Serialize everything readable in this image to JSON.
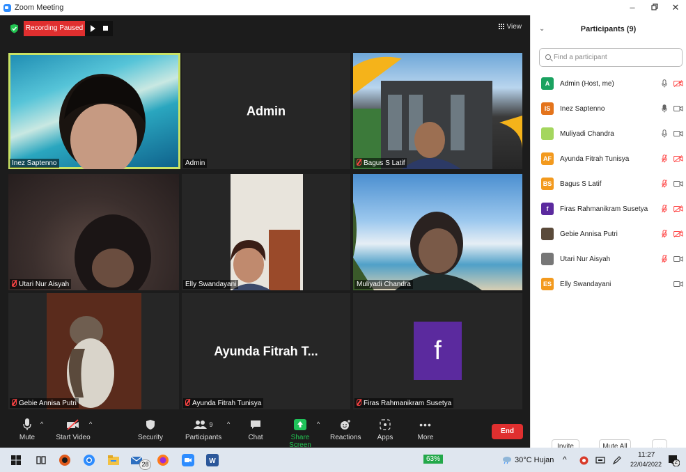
{
  "window": {
    "title": "Zoom Meeting"
  },
  "recording": {
    "label": "Recording Paused"
  },
  "view_button": {
    "label": "View"
  },
  "tiles": [
    {
      "name": "Inez Saptenno",
      "muted": false,
      "active": true,
      "big_name": "",
      "bg": "photo-beach"
    },
    {
      "name": "Admin",
      "muted": false,
      "active": false,
      "big_name": "Admin",
      "bg": "dark"
    },
    {
      "name": "Bagus S Latif",
      "muted": true,
      "active": false,
      "big_name": "",
      "bg": "photo-building"
    },
    {
      "name": "Utari Nur Aisyah",
      "muted": true,
      "active": false,
      "big_name": "",
      "bg": "photo-dim"
    },
    {
      "name": "Elly Swandayani",
      "muted": false,
      "active": false,
      "big_name": "",
      "bg": "photo-room"
    },
    {
      "name": "Muliyadi Chandra",
      "muted": false,
      "active": false,
      "big_name": "",
      "bg": "photo-sky"
    },
    {
      "name": "Gebie Annisa Putri",
      "muted": true,
      "active": false,
      "big_name": "",
      "bg": "photo-cat"
    },
    {
      "name": "Ayunda Fitrah Tunisya",
      "muted": true,
      "active": false,
      "big_name": "Ayunda Fitrah T...",
      "bg": "dark"
    },
    {
      "name": "Firas Rahmanikram Susetya",
      "muted": true,
      "active": false,
      "big_name": "",
      "bg": "avatar-f"
    }
  ],
  "avatar_f_letter": "f",
  "toolbar": {
    "mute": "Mute",
    "start_video": "Start Video",
    "security": "Security",
    "participants": "Participants",
    "participants_count": "9",
    "chat": "Chat",
    "share_screen": "Share Screen",
    "reactions": "Reactions",
    "apps": "Apps",
    "more": "More",
    "end": "End"
  },
  "panel": {
    "title": "Participants (9)",
    "search_placeholder": "Find a participant",
    "participants": [
      {
        "name": "Admin (Host, me)",
        "initials": "A",
        "color": "#1aa260",
        "mic": "on",
        "cam": "off"
      },
      {
        "name": "Inez Saptenno",
        "initials": "IS",
        "color": "#e4741c",
        "mic": "active",
        "cam": "on"
      },
      {
        "name": "Muliyadi Chandra",
        "initials": "",
        "color": "#a4d65e",
        "mic": "on",
        "cam": "on"
      },
      {
        "name": "Ayunda Fitrah Tunisya",
        "initials": "AF",
        "color": "#f39a1e",
        "mic": "off",
        "cam": "off"
      },
      {
        "name": "Bagus S Latif",
        "initials": "BS",
        "color": "#f39a1e",
        "mic": "off",
        "cam": "on"
      },
      {
        "name": "Firas Rahmanikram Susetya",
        "initials": "f",
        "color": "#5b2a9e",
        "mic": "off",
        "cam": "off"
      },
      {
        "name": "Gebie Annisa Putri",
        "initials": "",
        "color": "#5a4a3a",
        "mic": "off",
        "cam": "off"
      },
      {
        "name": "Utari Nur Aisyah",
        "initials": "",
        "color": "#777777",
        "mic": "off",
        "cam": "on"
      },
      {
        "name": "Elly Swandayani",
        "initials": "ES",
        "color": "#f39a1e",
        "mic": "none",
        "cam": "on"
      }
    ],
    "invite": "Invite",
    "mute_all": "Mute All",
    "more": "..."
  },
  "taskbar": {
    "badge_count": "28",
    "battery": "63%",
    "weather": "30°C Hujan",
    "time": "11:27",
    "date": "22/04/2022",
    "notification_count": "22"
  },
  "colors": {
    "stage_bg": "#1c1c1c",
    "tile_bg": "#262626",
    "active_speaker": "#c9e265",
    "end_red": "#e02f2f",
    "share_green": "#1fc35a",
    "muted_red": "#ff4444"
  }
}
